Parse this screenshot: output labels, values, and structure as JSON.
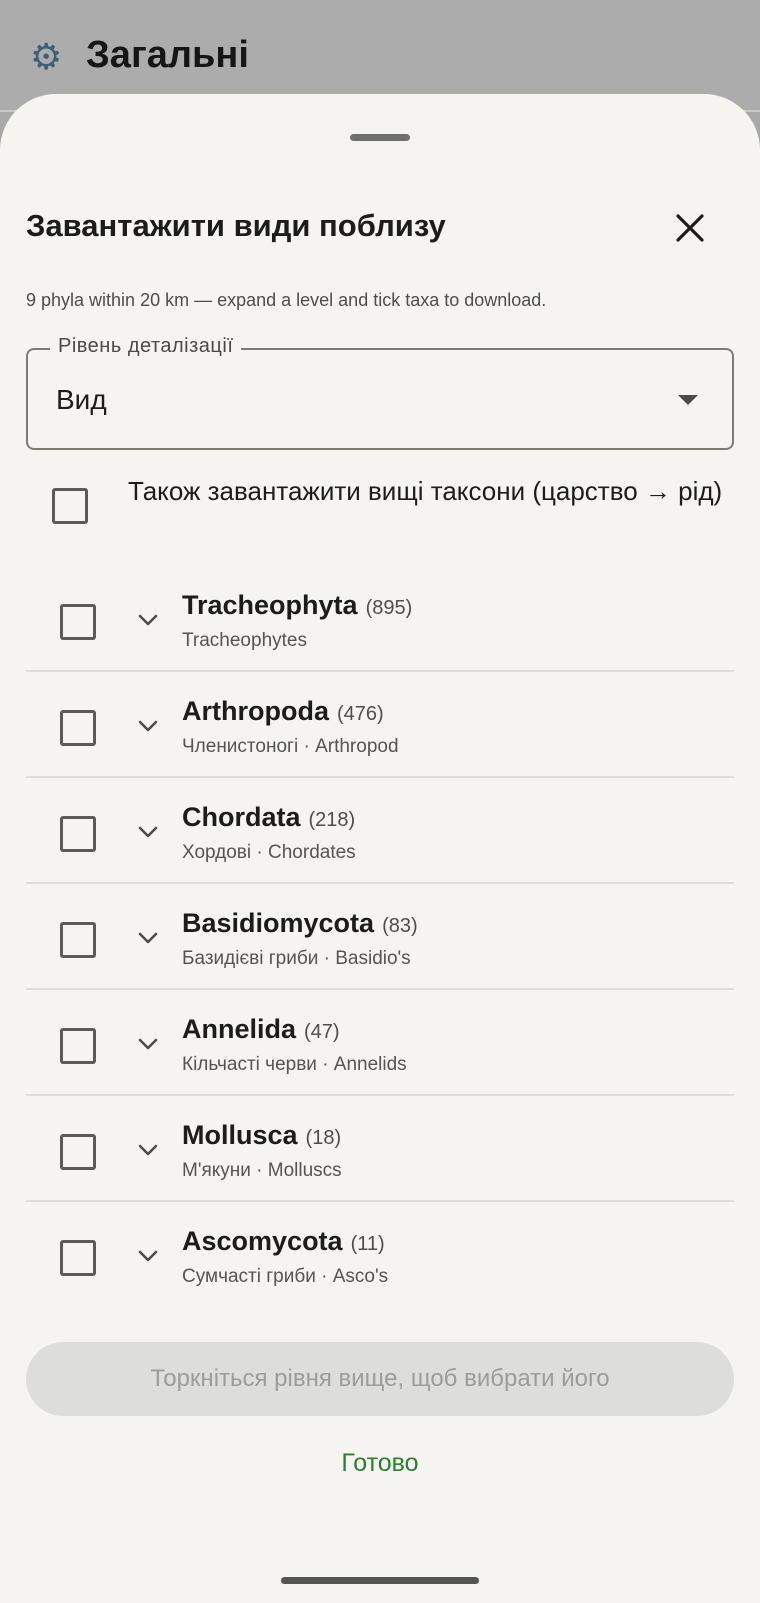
{
  "background": {
    "title": "Загальні",
    "icon": "gear-icon"
  },
  "sheet": {
    "title": "Завантажити види поблизу",
    "subtitle": "9 phyla within 20 km — expand a level and tick taxa to download.",
    "level_select": {
      "label": "Рівень деталізації",
      "value": "Вид"
    },
    "higher_taxa_label": "Також завантажити вищі таксони (царство → рід)",
    "taxa": [
      {
        "name": "Tracheophyta",
        "count": "(895)",
        "common": "Tracheophytes"
      },
      {
        "name": "Arthropoda",
        "count": "(476)",
        "common": "Членистоногі · Arthropod"
      },
      {
        "name": "Chordata",
        "count": "(218)",
        "common": "Хордові · Chordates"
      },
      {
        "name": "Basidiomycota",
        "count": "(83)",
        "common": "Базидієві гриби · Basidio's"
      },
      {
        "name": "Annelida",
        "count": "(47)",
        "common": "Кільчасті черви · Annelids"
      },
      {
        "name": "Mollusca",
        "count": "(18)",
        "common": "М'якуни · Molluscs"
      },
      {
        "name": "Ascomycota",
        "count": "(11)",
        "common": "Сумчасті гриби · Asco's"
      }
    ],
    "action_label": "Торкніться рівня вище, щоб вибрати його",
    "done_label": "Готово"
  },
  "colors": {
    "accent": "#2e7d32",
    "sheet_bg": "#f5f4f1"
  }
}
